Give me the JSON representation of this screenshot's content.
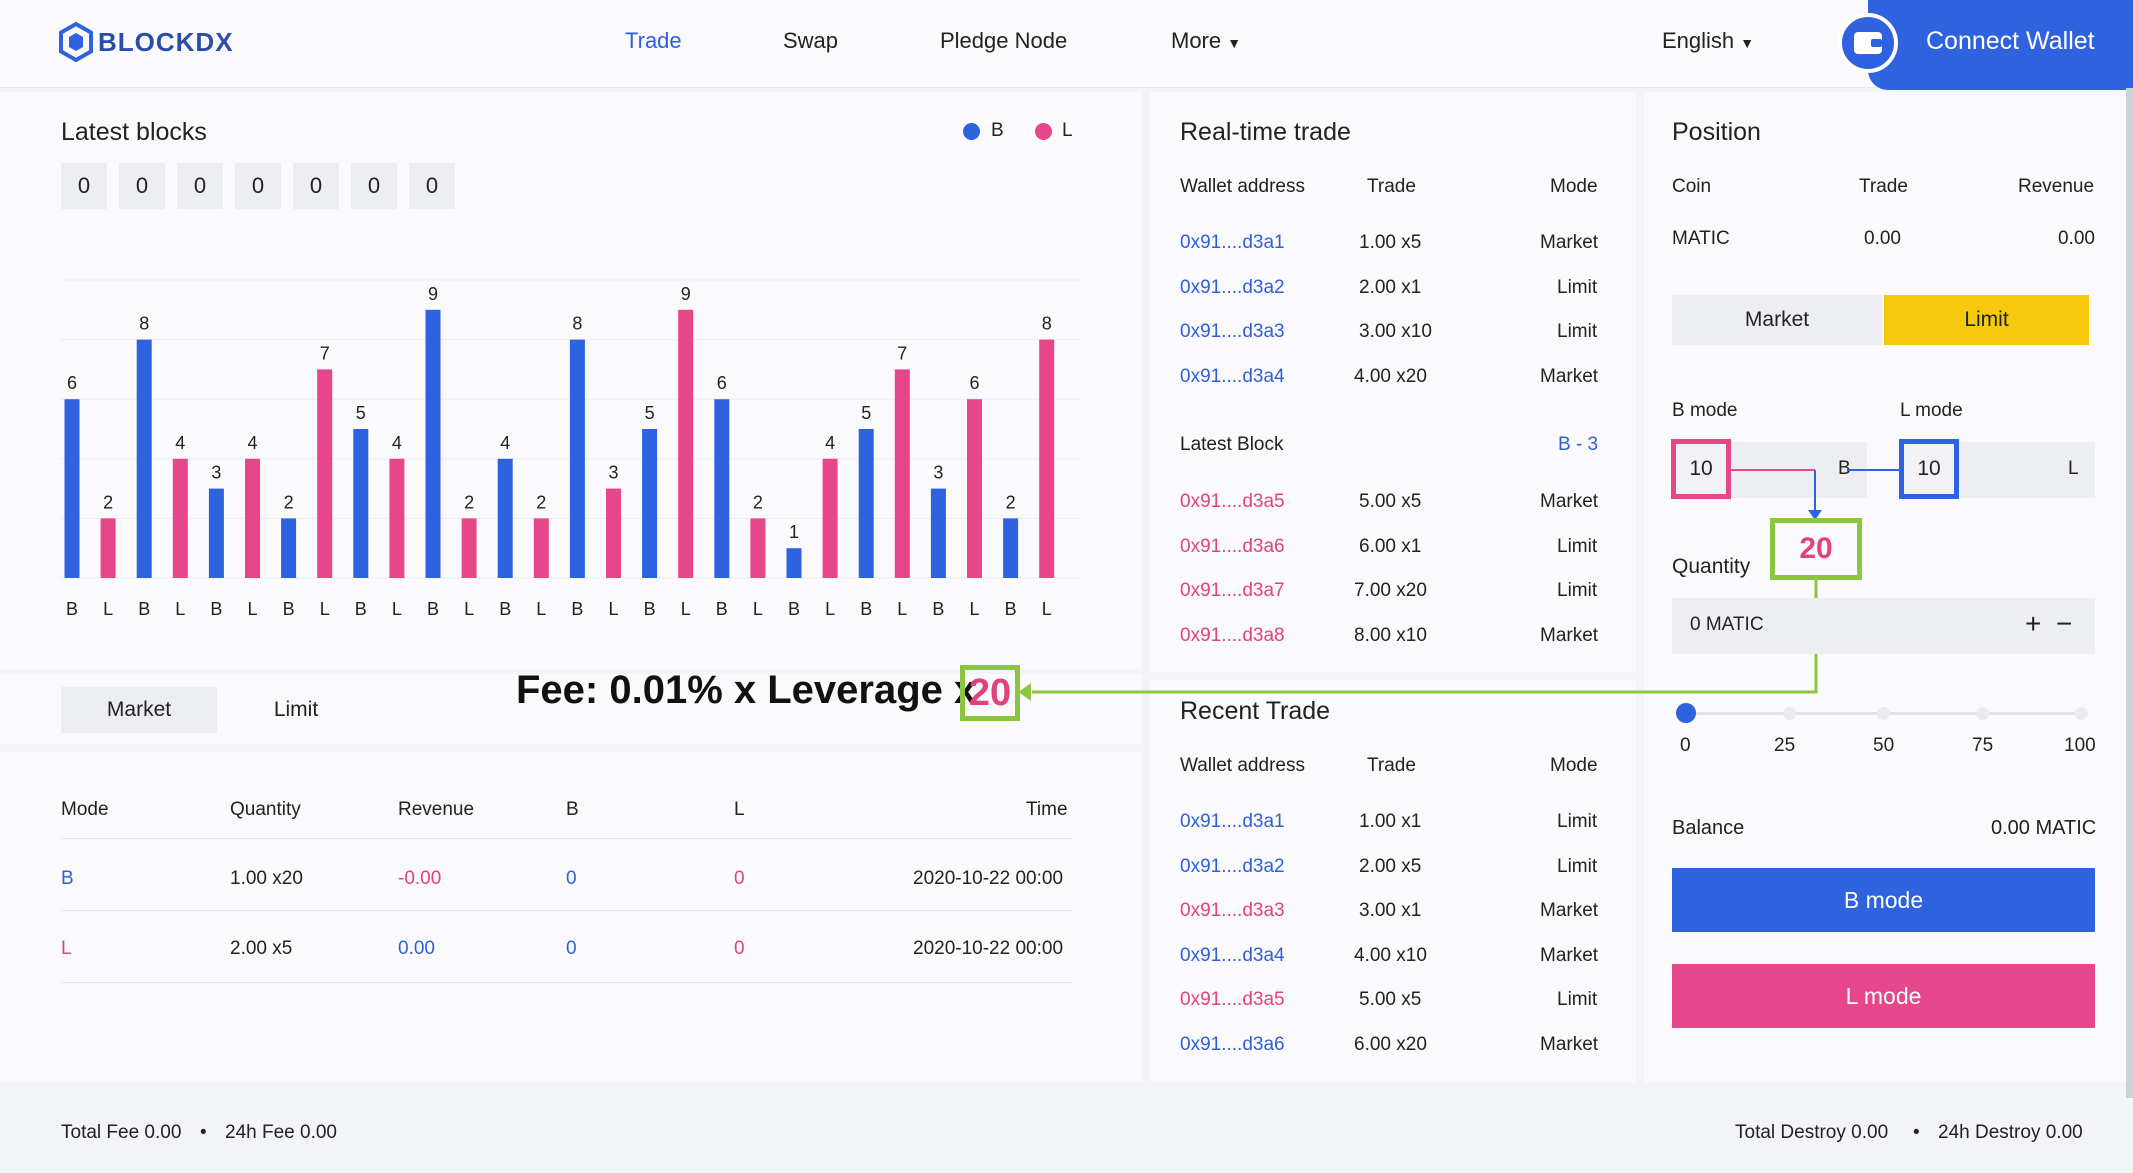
{
  "header": {
    "logo": "BLOCKDX",
    "nav": [
      "Trade",
      "Swap",
      "Pledge Node",
      "More"
    ],
    "language": "English",
    "connect_wallet": "Connect Wallet"
  },
  "latest_blocks": {
    "title": "Latest blocks",
    "legend": [
      "B",
      "L"
    ],
    "digits": [
      "0",
      "0",
      "0",
      "0",
      "0",
      "0",
      "0"
    ]
  },
  "colors": {
    "b": "#2f62de",
    "l": "#e5478a",
    "accent": "#8cc63f",
    "limit": "#f6c90c"
  },
  "chart_data": {
    "type": "bar",
    "categories": [
      "B",
      "L",
      "B",
      "L",
      "B",
      "L",
      "B",
      "L",
      "B",
      "L",
      "B",
      "L",
      "B",
      "L",
      "B",
      "L",
      "B",
      "L",
      "B",
      "L",
      "B",
      "L",
      "B",
      "L",
      "B",
      "L",
      "B",
      "L"
    ],
    "values": [
      6,
      2,
      8,
      4,
      3,
      4,
      2,
      7,
      5,
      4,
      9,
      2,
      4,
      2,
      8,
      3,
      5,
      9,
      6,
      2,
      1,
      4,
      5,
      7,
      3,
      6,
      2,
      8
    ],
    "series_colors_by_category": {
      "B": "#2f62de",
      "L": "#e5478a"
    },
    "ylim": [
      0,
      10
    ],
    "legend": [
      "B",
      "L"
    ],
    "legend_position": "top-right",
    "grid": true
  },
  "order_tabs": {
    "market": "Market",
    "limit": "Limit"
  },
  "fee": {
    "text": "Fee: 0.01% x Leverage x",
    "value": "20"
  },
  "orders": {
    "headers": [
      "Mode",
      "Quantity",
      "Revenue",
      "B",
      "L",
      "Time"
    ],
    "rows": [
      {
        "mode": "B",
        "quantity": "1.00 x20",
        "revenue": "-0.00",
        "b": "0",
        "l": "0",
        "time": "2020-10-22 00:00"
      },
      {
        "mode": "L",
        "quantity": "2.00 x5",
        "revenue": "0.00",
        "b": "0",
        "l": "0",
        "time": "2020-10-22 00:00"
      }
    ]
  },
  "footer": {
    "total_fee": "Total Fee 0.00",
    "fee_24h": "24h Fee 0.00",
    "total_destroy": "Total Destroy 0.00",
    "destroy_24h": "24h Destroy 0.00",
    "dot": "•"
  },
  "realtime": {
    "title": "Real-time trade",
    "headers": [
      "Wallet address",
      "Trade",
      "Mode"
    ],
    "rows": [
      {
        "addr": "0x91....d3a1",
        "trade": "1.00 x5",
        "mode": "Market"
      },
      {
        "addr": "0x91....d3a2",
        "trade": "2.00 x1",
        "mode": "Limit"
      },
      {
        "addr": "0x91....d3a3",
        "trade": "3.00 x10",
        "mode": "Limit"
      },
      {
        "addr": "0x91....d3a4",
        "trade": "4.00 x20",
        "mode": "Market"
      }
    ],
    "latest_block_label": "Latest Block",
    "latest_block_value": "B - 3",
    "block_rows": [
      {
        "addr": "0x91....d3a5",
        "trade": "5.00 x5",
        "mode": "Market"
      },
      {
        "addr": "0x91....d3a6",
        "trade": "6.00 x1",
        "mode": "Limit"
      },
      {
        "addr": "0x91....d3a7",
        "trade": "7.00 x20",
        "mode": "Limit"
      },
      {
        "addr": "0x91....d3a8",
        "trade": "8.00 x10",
        "mode": "Market"
      }
    ]
  },
  "recent": {
    "title": "Recent Trade",
    "headers": [
      "Wallet address",
      "Trade",
      "Mode"
    ],
    "rows": [
      {
        "addr": "0x91....d3a1",
        "trade": "1.00 x1",
        "mode": "Limit",
        "color": "blue"
      },
      {
        "addr": "0x91....d3a2",
        "trade": "2.00 x5",
        "mode": "Limit",
        "color": "blue"
      },
      {
        "addr": "0x91....d3a3",
        "trade": "3.00 x1",
        "mode": "Market",
        "color": "pink"
      },
      {
        "addr": "0x91....d3a4",
        "trade": "4.00 x10",
        "mode": "Market",
        "color": "blue"
      },
      {
        "addr": "0x91....d3a5",
        "trade": "5.00 x5",
        "mode": "Limit",
        "color": "pink"
      },
      {
        "addr": "0x91....d3a6",
        "trade": "6.00 x20",
        "mode": "Market",
        "color": "blue"
      }
    ]
  },
  "position": {
    "title": "Position",
    "headers": [
      "Coin",
      "Trade",
      "Revenue"
    ],
    "row": {
      "coin": "MATIC",
      "trade": "0.00",
      "revenue": "0.00"
    },
    "tabs": {
      "market": "Market",
      "limit": "Limit"
    },
    "b_mode_label": "B mode",
    "l_mode_label": "L mode",
    "b_value": "10",
    "b_letter": "B",
    "l_value": "10",
    "l_letter": "L",
    "quantity_label": "Quantity",
    "quantity_big": "20",
    "quantity_value": "0 MATIC",
    "plus": "+",
    "minus": "−",
    "slider_ticks": [
      "0",
      "25",
      "50",
      "75",
      "100"
    ],
    "slider_value": 0,
    "balance_label": "Balance",
    "balance_value": "0.00 MATIC",
    "btn_b": "B mode",
    "btn_l": "L mode"
  }
}
